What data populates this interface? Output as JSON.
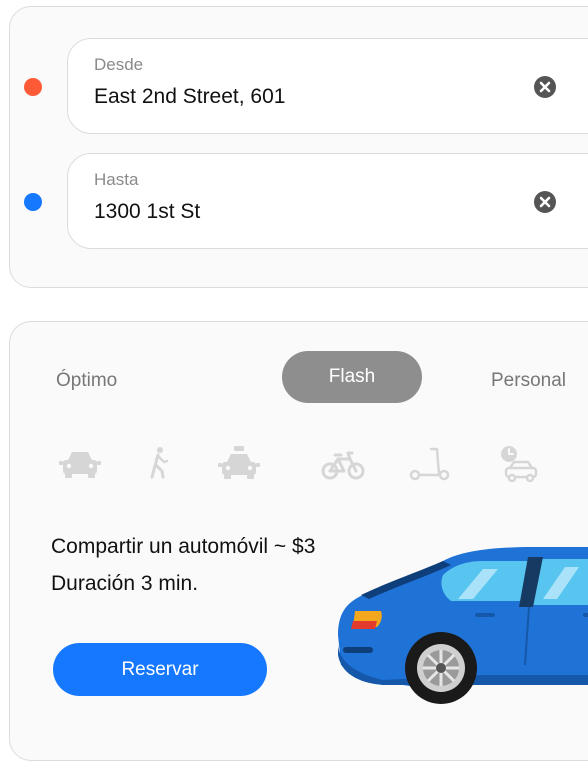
{
  "route": {
    "from": {
      "label": "Desde",
      "value": "East 2nd Street, 601",
      "dot_color": "#ff5a36"
    },
    "to": {
      "label": "Hasta",
      "value": "1300 1st St",
      "dot_color": "#1677ff"
    }
  },
  "tabs": [
    {
      "label": "Óptimo",
      "active": false
    },
    {
      "label": "Flash",
      "active": true
    },
    {
      "label": "Personal",
      "active": false
    }
  ],
  "modes": [
    {
      "icon": "car-icon"
    },
    {
      "icon": "walk-icon"
    },
    {
      "icon": "taxi-icon"
    },
    {
      "icon": "bicycle-icon"
    },
    {
      "icon": "scooter-icon"
    },
    {
      "icon": "scheduled-ride-icon"
    }
  ],
  "summary": {
    "line1": "Compartir un automóvil ~ $3",
    "line2": "Duración 3 min."
  },
  "reserve_button": "Reservar",
  "colors": {
    "accent": "#1677ff",
    "origin": "#ff5a36",
    "active_tab": "#8e8e8e",
    "car_body": "#1f72d6"
  }
}
